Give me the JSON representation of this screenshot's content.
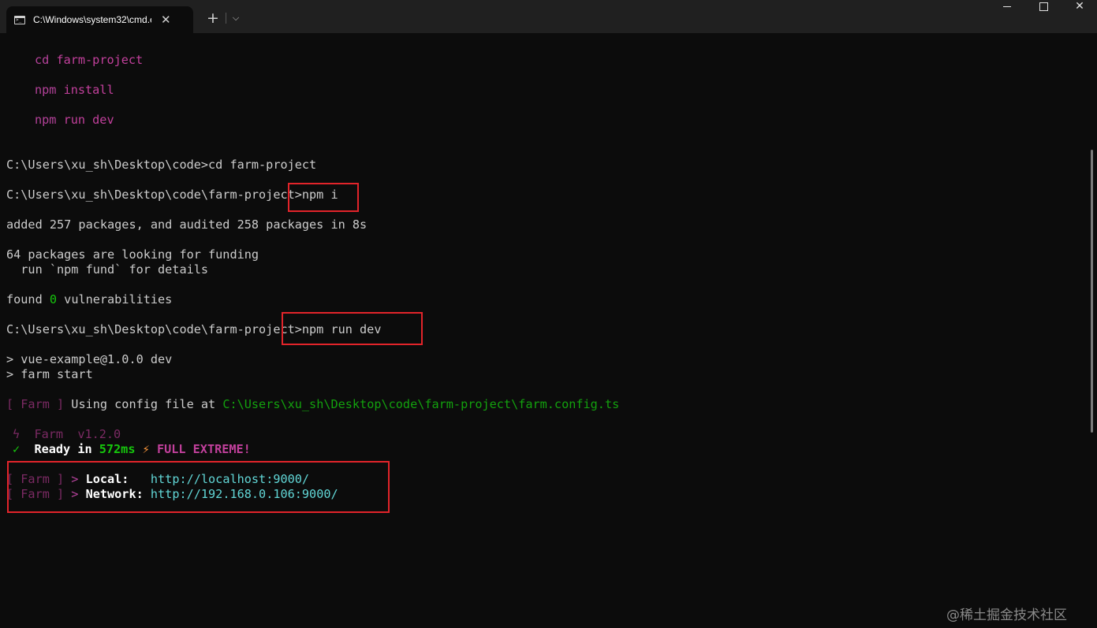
{
  "window": {
    "tab_title": "C:\\Windows\\system32\\cmd.exe",
    "tab_close": "✕",
    "new_tab": "+",
    "dropdown": "⌵",
    "close_glyph": "✕"
  },
  "terminal": {
    "l1_cmd": "cd",
    "l1_arg": "farm-project",
    "l2_cmd": "npm",
    "l2_arg": "install",
    "l3_cmd": "npm",
    "l3_arg": "run dev",
    "prompt1": "C:\\Users\\xu_sh\\Desktop\\code>cd farm-project",
    "prompt2_path": "C:\\Users\\xu_sh\\Desktop\\code\\farm-project>",
    "prompt2_cmd": "npm i",
    "added": "added 257 packages, and audited 258 packages in 8s",
    "funding1": "64 packages are looking for funding",
    "funding2": "  run `npm fund` for details",
    "found_pre": "found ",
    "found_num": "0",
    "found_post": " vulnerabilities",
    "prompt3_path": "C:\\Users\\xu_sh\\Desktop\\code\\farm-project>",
    "prompt3_cmd": "npm run dev",
    "script1": "> vue-example@1.0.0 dev",
    "script2": "> farm start",
    "farm_tag": "[ Farm ]",
    "config_text": " Using config file at ",
    "config_path": "C:\\Users\\xu_sh\\Desktop\\code\\farm-project\\farm.config.ts",
    "farm_version_icon": "ϟ",
    "farm_version": "Farm  v1.2.0",
    "ready_check": "✓",
    "ready_text": "Ready in ",
    "ready_time": "572ms",
    "lightning": "⚡",
    "full_extreme": "FULL EXTREME!",
    "arrow": " > ",
    "local_label": "Local:   ",
    "local_url": "http://localhost:9000/",
    "network_label": "Network: ",
    "network_url": "http://192.168.0.106:9000/"
  },
  "watermark": "@稀土掘金技术社区",
  "colors": {
    "background": "#0c0c0c",
    "titlebar": "#202020",
    "highlight_box": "#e2242a",
    "magenta": "#b4429a",
    "green": "#13a10e",
    "cyan": "#61d6d6"
  }
}
